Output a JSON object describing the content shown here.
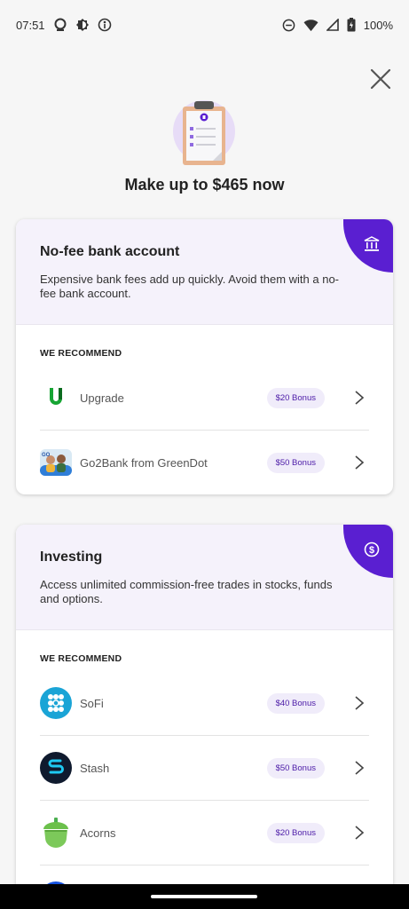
{
  "status": {
    "time": "07:51",
    "battery": "100%"
  },
  "headline": "Make up to $465 now",
  "cards": [
    {
      "title": "No-fee bank account",
      "description": "Expensive bank fees add up quickly. Avoid them with a no-fee bank account.",
      "section_label": "WE RECOMMEND",
      "corner_icon": "bank-icon",
      "items": [
        {
          "name": "Upgrade",
          "bonus": "$20 Bonus",
          "logo": "upgrade-logo"
        },
        {
          "name": "Go2Bank from GreenDot",
          "bonus": "$50 Bonus",
          "logo": "go2bank-logo"
        }
      ]
    },
    {
      "title": "Investing",
      "description": "Access unlimited commission-free trades in stocks, funds and options.",
      "section_label": "WE RECOMMEND",
      "corner_icon": "dollar-coin-icon",
      "items": [
        {
          "name": "SoFi",
          "bonus": "$40 Bonus",
          "logo": "sofi-logo"
        },
        {
          "name": "Stash",
          "bonus": "$50 Bonus",
          "logo": "stash-logo"
        },
        {
          "name": "Acorns",
          "bonus": "$20 Bonus",
          "logo": "acorns-logo"
        }
      ]
    }
  ],
  "colors": {
    "accent": "#5a1fd1",
    "card_header_bg": "#f5f2fb",
    "bonus_text": "#4b1aa7",
    "bonus_bg": "#f0ecfa"
  }
}
